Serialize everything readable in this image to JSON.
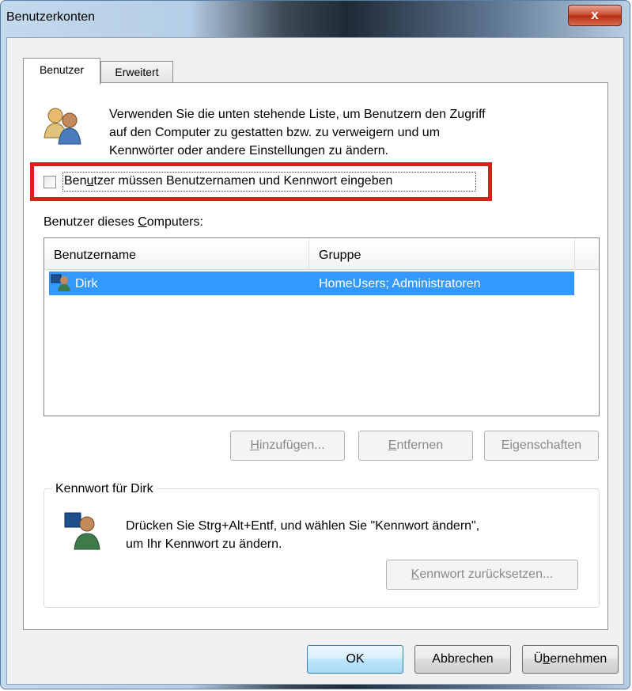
{
  "window": {
    "title": "Benutzerkonten",
    "close_glyph": "x"
  },
  "tabs": [
    {
      "label": "Benutzer",
      "selected": true
    },
    {
      "label": "Erweitert",
      "selected": false
    }
  ],
  "intro": {
    "icon": "users-icon",
    "line1": "Verwenden Sie die unten stehende Liste, um Benutzern den Zugriff",
    "line2": "auf den Computer zu gestatten bzw. zu verweigern und um",
    "line3": "Kennwörter oder andere Einstellungen zu ändern."
  },
  "require_login": {
    "label_pre": "Ben",
    "label_accel": "u",
    "label_post": "tzer müssen Benutzernamen und Kennwort eingeben",
    "checked": false
  },
  "users_section": {
    "label_pre": "Benutzer dieses ",
    "label_accel": "C",
    "label_post": "omputers:"
  },
  "users_table": {
    "columns": [
      "Benutzername",
      "Gruppe"
    ],
    "rows": [
      {
        "icon": "user-icon",
        "name": "Dirk",
        "group": "HomeUsers; Administratoren",
        "selected": true
      }
    ]
  },
  "list_buttons": {
    "add_accel": "H",
    "add_rest": "inzufügen...",
    "remove_accel": "E",
    "remove_rest": "ntfernen",
    "props_pre": "Ei",
    "props_accel": "g",
    "props_post": "enschaften"
  },
  "password_group": {
    "legend": "Kennwort für Dirk",
    "icon": "user-password-icon",
    "line1": "Drücken Sie Strg+Alt+Entf, und wählen Sie \"Kennwort ändern\",",
    "line2": "um Ihr Kennwort zu ändern.",
    "reset_accel": "K",
    "reset_rest": "ennwort zurücksetzen..."
  },
  "dialog_buttons": {
    "ok": "OK",
    "cancel": "Abbrechen",
    "apply_pre": "Ü",
    "apply_accel": "b",
    "apply_post": "ernehmen"
  },
  "colors": {
    "selection": "#3399ff",
    "highlight_frame": "#e21b1b",
    "dialog_bg": "#f0f0f0"
  }
}
